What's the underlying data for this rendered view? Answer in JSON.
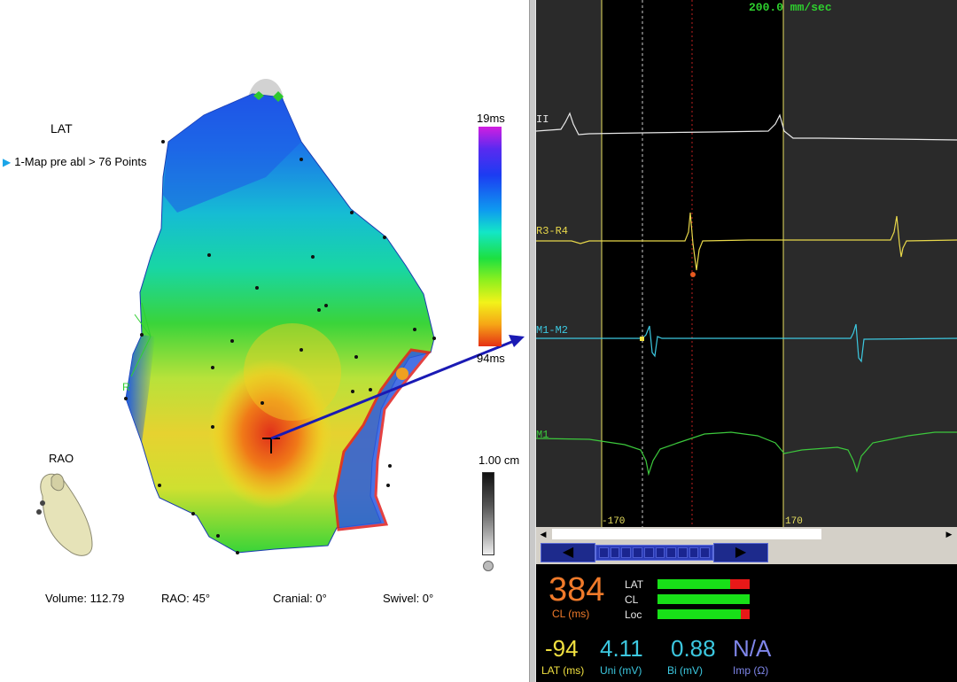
{
  "map": {
    "measure_title": "LAT",
    "map_entry": "1-Map pre abl > 76 Points",
    "scale_top": "19ms",
    "scale_bottom": "94ms",
    "ruler_label": "1.00 cm",
    "view_label": "RAO",
    "orientation_marker": "R",
    "status": {
      "volume": "Volume:  112.79",
      "rao": "RAO: 45°",
      "cranial": "Cranial: 0°",
      "swivel": "Swivel: 0°"
    }
  },
  "ecg": {
    "sweep_speed": "200.0 mm/sec",
    "channels": [
      {
        "label": "II",
        "color": "#e8e8e8"
      },
      {
        "label": "R3-R4",
        "color": "#e8d84a"
      },
      {
        "label": "M1-M2",
        "color": "#3cc8e0"
      },
      {
        "label": "M1",
        "color": "#3cc83c"
      }
    ],
    "window_left_label": "-170",
    "window_right_label": "170"
  },
  "info_panel": {
    "cl_value": "384",
    "cl_label": "CL (ms)",
    "bars": [
      {
        "label": "LAT",
        "fill": 0.78
      },
      {
        "label": "CL",
        "fill": 1.0
      },
      {
        "label": "Loc",
        "fill": 0.9
      }
    ],
    "readouts": [
      {
        "value": "-94",
        "label": "LAT (ms)",
        "color": "#f0e040"
      },
      {
        "value": "4.11",
        "label": "Uni (mV)",
        "color": "#3cc8e0"
      },
      {
        "value": "0.88",
        "label": "Bi (mV)",
        "color": "#3cc8e0"
      },
      {
        "value": "N/A",
        "label": "Imp (Ω)",
        "color": "#7f86ea"
      }
    ]
  },
  "colors": {
    "accent_orange": "#f07a2a",
    "bar_green": "#18e018",
    "bar_red": "#e81818",
    "nav_blue": "#1d2a8c"
  }
}
